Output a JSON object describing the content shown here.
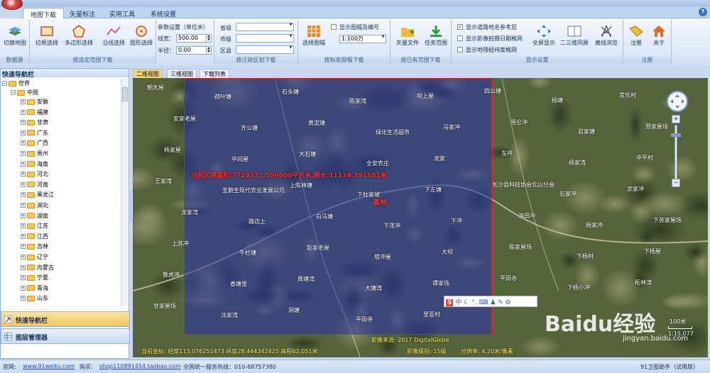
{
  "ribbon_tabs": [
    "地图下载",
    "矢量标注",
    "实用工具",
    "系统设置"
  ],
  "groups": {
    "datasource": {
      "label": "数据源",
      "switch_map": "切换地图"
    },
    "range": {
      "label": "按选定范围下载",
      "rect": "拉框选择",
      "polygon": "多边形选择",
      "line": "沿线选择",
      "circle": "圆形选择"
    },
    "params": {
      "title": "参数设置（单位米）",
      "line_width_label": "线宽：",
      "line_width_value": "500.00",
      "radius_label": "半径：",
      "radius_value": "0.00"
    },
    "admin": {
      "label": "按迁政区划下载",
      "province": "省级",
      "city": "市级",
      "district": "区县"
    },
    "sheet": {
      "label": "按标准图幅下载",
      "select": "选择图幅",
      "show_number": "显示图幅及编号",
      "scale": "1:100万"
    },
    "existing": {
      "label": "按已有范围下载",
      "vector_file": "矢量文件",
      "task_range": "任务范围"
    },
    "display": {
      "label": "显示设置",
      "road_names": "显示道路地名参考层",
      "image_date": "显示影像拍摄日期格网",
      "lat_lon": "显示地理经纬度格网",
      "fullscreen": "全屏显示",
      "dual_screen": "二三维同屏",
      "offline": "离线浏览"
    },
    "register": {
      "label": "注册",
      "register": "注册",
      "about": "关于"
    }
  },
  "left": {
    "header": "快速导航栏",
    "root": "世界",
    "country": "中国",
    "provinces": [
      "安徽",
      "福建",
      "甘肃",
      "广东",
      "广西",
      "贵州",
      "海南",
      "河北",
      "河南",
      "黑龙江",
      "湖北",
      "湖南",
      "江苏",
      "江西",
      "吉林",
      "辽宁",
      "内蒙古",
      "宁夏",
      "青海",
      "山东"
    ],
    "nav_fast": "快速导航栏",
    "nav_layers": "图层管理器"
  },
  "map_tabs": [
    "二维视图",
    "三维视图",
    "下载列表"
  ],
  "map": {
    "area_info": "当前区域面积:7729271.050000平方米,周长:11134.391581米",
    "base_label": "基地",
    "places": [
      "朝天屋",
      "荷叶塘",
      "石头塘",
      "陈家湾",
      "坝上屋",
      "四公塘",
      "杨塘",
      "常乐村",
      "安家老屋",
      "齐公塘",
      "黄泥塘",
      "绿化生活超市",
      "马家冲",
      "围仑冲",
      "岩家塘",
      "聂家屋场",
      "杨家屋",
      "中间屋",
      "大石塘",
      "全安农庄",
      "龙家",
      "东坪",
      "杨家湾",
      "中平村",
      "王家湾",
      "圣鹅生现代农业发展公司",
      "上陈林塘",
      "下杜家坡",
      "下左塘",
      "长沙县科技协会北山分会",
      "石家冲",
      "余家冲",
      "龙家湾",
      "路边上",
      "白马塘",
      "下泽冲",
      "下冲",
      "滚田冲",
      "杨家冲",
      "下苏家屋场",
      "上苏冲",
      "牛栏塘",
      "彭家老屋",
      "塔冲屋",
      "大坝",
      "陈家屋场",
      "下杨村",
      "下杨屋",
      "鲁虎冲",
      "香塘里",
      "周塘湾",
      "大塘湾",
      "谭家场",
      "平田寺",
      "下杨小冲",
      "柘林湾",
      "甘家屋场",
      "沈家湾",
      "洞塘",
      "平田寺",
      "里亚村"
    ],
    "source": "影像来源: 2017 DigitalGlobe",
    "coords": "当前坐标: 经度113.076251473 纬度28.444342425 高程62.051米",
    "level": "影像级别: 15级",
    "resolution": "分辨率: 4.20米/像素",
    "scale_label": "100米",
    "scale_sub": "1:15,077",
    "watermark": "Baidu经验",
    "watermark_url": "jingyan.baidu.com"
  },
  "status": {
    "website_label": "官网:",
    "website": "www.91weitu.com",
    "buy_label": "购买:",
    "shop": "shop110891454.taobao.com",
    "hotline": "全国统一服务热线：010-88757380",
    "version": "91卫图助手（试用版）"
  }
}
